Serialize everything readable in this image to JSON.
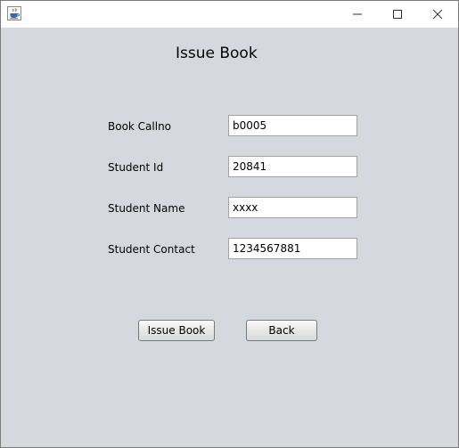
{
  "window": {
    "icon": "java-coffee-cup-icon",
    "controls": [
      "minimize-icon",
      "maximize-icon",
      "close-icon"
    ]
  },
  "form": {
    "title": "Issue Book",
    "fields": [
      {
        "label": "Book Callno",
        "value": "b0005"
      },
      {
        "label": "Student Id",
        "value": "20841"
      },
      {
        "label": "Student Name",
        "value": "xxxx"
      },
      {
        "label": "Student Contact",
        "value": "1234567881"
      }
    ],
    "issue_button": "Issue Book",
    "back_button": "Back"
  }
}
